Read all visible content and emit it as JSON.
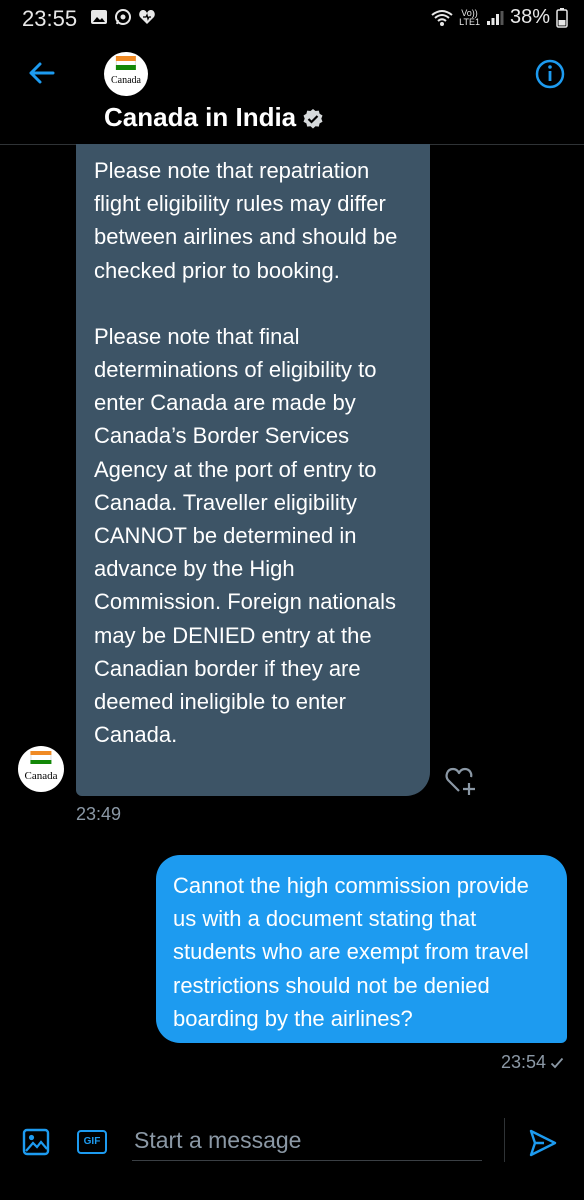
{
  "status_bar": {
    "time": "23:55",
    "volte_top": "Vo))",
    "volte_bottom": "LTE1",
    "battery": "38%"
  },
  "header": {
    "avatar_text": "Canada",
    "name": "Canada in India",
    "accent_color": "#1d9bf0"
  },
  "messages": [
    {
      "direction": "incoming",
      "avatar_text": "Canada",
      "paragraphs": [
        "Please note that repatriation flight eligibility rules may differ between airlines and should be checked prior to booking.",
        "Please note that final determinations of eligibility to enter Canada are made by Canada’s Border Services Agency at the port of entry to Canada. Traveller eligibility CANNOT be determined in advance by the High Commission. Foreign nationals may be DENIED entry at the Canadian border if they are deemed ineligible to enter Canada."
      ],
      "time": "23:49",
      "bubble_color": "#3d5466"
    },
    {
      "direction": "outgoing",
      "text": "Cannot the high commission provide us with a document stating that students who are exempt from travel restrictions should not be denied boarding by the airlines?",
      "time": "23:54",
      "bubble_color": "#1d9bf0"
    }
  ],
  "composer": {
    "gif_label": "GIF",
    "placeholder": "Start a message"
  }
}
